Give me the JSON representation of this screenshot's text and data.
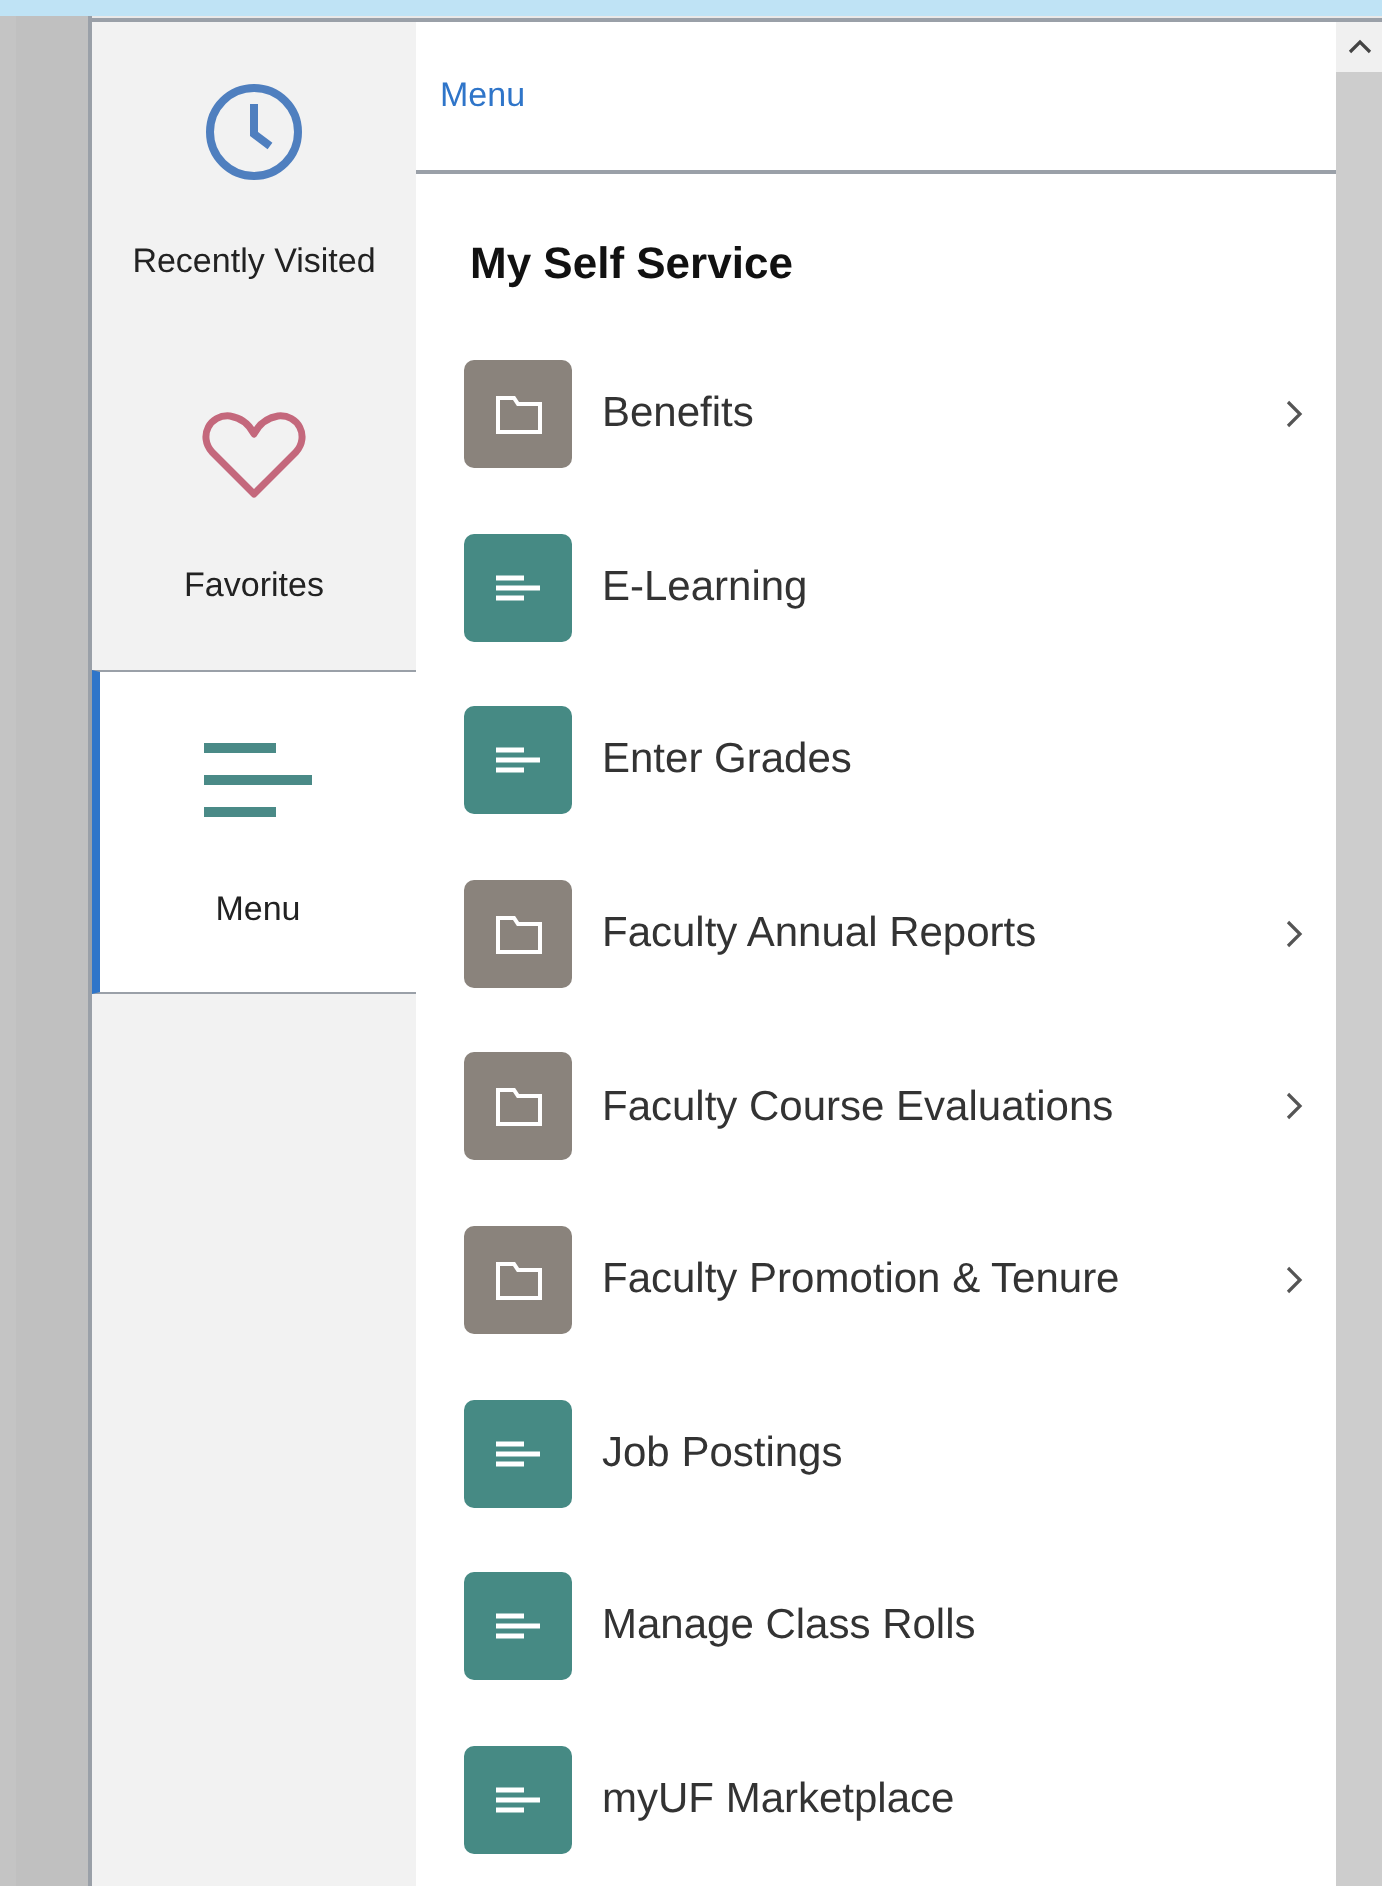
{
  "sidebar": {
    "items": [
      {
        "label": "Recently Visited",
        "kind": "clock",
        "selected": false
      },
      {
        "label": "Favorites",
        "kind": "heart",
        "selected": false
      },
      {
        "label": "Menu",
        "kind": "menu",
        "selected": true
      }
    ]
  },
  "breadcrumb": "Menu",
  "section_title": "My Self Service",
  "items": [
    {
      "label": "Benefits",
      "kind": "folder"
    },
    {
      "label": "E-Learning",
      "kind": "page"
    },
    {
      "label": "Enter Grades",
      "kind": "page"
    },
    {
      "label": "Faculty Annual Reports",
      "kind": "folder"
    },
    {
      "label": "Faculty Course Evaluations",
      "kind": "folder"
    },
    {
      "label": "Faculty Promotion & Tenure",
      "kind": "folder"
    },
    {
      "label": "Job Postings",
      "kind": "page"
    },
    {
      "label": "Manage Class Rolls",
      "kind": "page"
    },
    {
      "label": "myUF Marketplace",
      "kind": "page"
    }
  ]
}
